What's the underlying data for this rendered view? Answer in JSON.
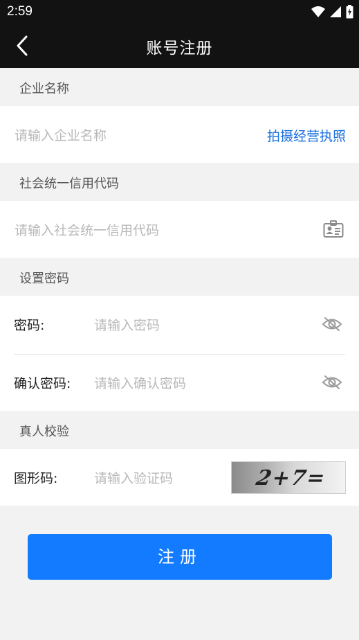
{
  "status_bar": {
    "time": "2:59"
  },
  "header": {
    "title": "账号注册"
  },
  "sections": {
    "company": {
      "header": "企业名称",
      "placeholder": "请输入企业名称",
      "action": "拍摄经营执照"
    },
    "credit_code": {
      "header": "社会统一信用代码",
      "placeholder": "请输入社会统一信用代码"
    },
    "password": {
      "header": "设置密码",
      "password_label": "密码:",
      "password_placeholder": "请输入密码",
      "confirm_label": "确认密码:",
      "confirm_placeholder": "请输入确认密码"
    },
    "verify": {
      "header": "真人校验",
      "captcha_label": "图形码:",
      "captcha_placeholder": "请输入验证码",
      "captcha_image_text": "2+7="
    }
  },
  "submit_label": "注册",
  "colors": {
    "accent": "#127bff",
    "link": "#1a6fe0",
    "bar": "#121212"
  },
  "icons": {
    "back": "chevron-left-icon",
    "id_card": "id-card-icon",
    "eye": "eye-off-icon"
  }
}
